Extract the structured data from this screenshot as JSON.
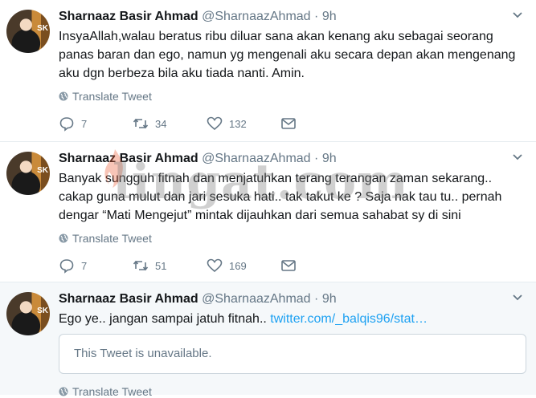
{
  "tweets": [
    {
      "name": "Sharnaaz Basir Ahmad",
      "handle": "@SharnaazAhmad",
      "separator": "·",
      "time": "9h",
      "text": "InsyaAllah,walau beratus ribu diluar sana akan kenang aku sebagai seorang panas baran dan ego, namun yg mengenali aku secara depan akan mengenang aku dgn berbeza bila aku tiada nanti. Amin.",
      "translate": "Translate Tweet",
      "replies": "7",
      "retweets": "34",
      "likes": "132"
    },
    {
      "name": "Sharnaaz Basir Ahmad",
      "handle": "@SharnaazAhmad",
      "separator": "·",
      "time": "9h",
      "text": "Banyak sungguh fitnah dan menjatuhkan terang terangan zaman sekarang.. cakap guna mulut dan jari sesuka hati.. tak takut ke ? Saja nak tau tu.. pernah dengar “Mati Mengejut” mintak dijauhkan dari semua sahabat sy di sini",
      "translate": "Translate Tweet",
      "replies": "7",
      "retweets": "51",
      "likes": "169"
    },
    {
      "name": "Sharnaaz Basir Ahmad",
      "handle": "@SharnaazAhmad",
      "separator": "·",
      "time": "9h",
      "text": "Ego ye.. jangan sampai jatuh fitnah..",
      "link": "twitter.com/_balqis96/stat…",
      "quoted_text": "This Tweet is unavailable.",
      "translate": "Translate Tweet"
    }
  ],
  "watermark": "lingat.com",
  "avatar_label": "SK",
  "colors": {
    "link": "#1da1f2",
    "muted": "#657786",
    "border": "#e6ecf0"
  },
  "icons": [
    "chevron-down-icon",
    "globe-icon",
    "reply-icon",
    "retweet-icon",
    "heart-icon",
    "message-icon"
  ]
}
